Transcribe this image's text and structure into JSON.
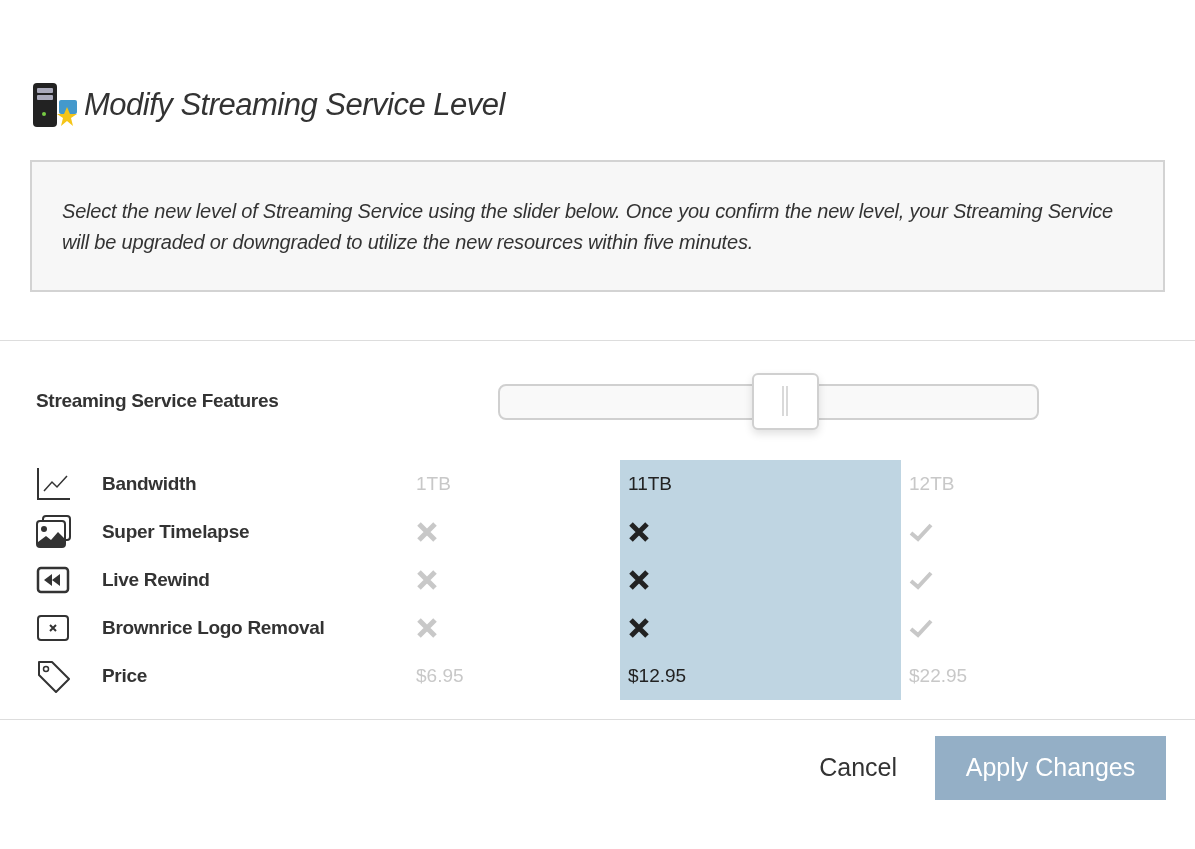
{
  "dialog": {
    "title": "Modify Streaming Service Level"
  },
  "info": "Select the new level of Streaming Service using the slider below. Once you confirm the new level, your Streaming Service will be upgraded or downgraded to utilize the new resources within five minutes.",
  "features_heading": "Streaming Service Features",
  "slider": {
    "level": 0.53
  },
  "tiers": [
    {
      "selected": false
    },
    {
      "selected": true
    },
    {
      "selected": false
    }
  ],
  "features": [
    {
      "kind": "chart",
      "label": "Bandwidth",
      "cells": [
        {
          "kind": "text",
          "text": "1TB"
        },
        {
          "kind": "text",
          "text": "11TB"
        },
        {
          "kind": "text",
          "text": "12TB"
        }
      ]
    },
    {
      "kind": "images",
      "label": "Super Timelapse",
      "cells": [
        {
          "kind": "flag",
          "included": false
        },
        {
          "kind": "flag",
          "included": false
        },
        {
          "kind": "flag",
          "included": true
        }
      ]
    },
    {
      "kind": "rewind",
      "label": "Live Rewind",
      "cells": [
        {
          "kind": "flag",
          "included": false
        },
        {
          "kind": "flag",
          "included": false
        },
        {
          "kind": "flag",
          "included": true
        }
      ]
    },
    {
      "kind": "xbox",
      "label": "Brownrice Logo Removal",
      "cells": [
        {
          "kind": "flag",
          "included": false
        },
        {
          "kind": "flag",
          "included": false
        },
        {
          "kind": "flag",
          "included": true
        }
      ]
    },
    {
      "kind": "tag",
      "label": "Price",
      "cells": [
        {
          "kind": "text",
          "text": "$6.95"
        },
        {
          "kind": "text",
          "text": "$12.95"
        },
        {
          "kind": "text",
          "text": "$22.95"
        }
      ]
    }
  ],
  "buttons": {
    "cancel": "Cancel",
    "apply": {
      "label": "Apply Changes",
      "disabled": true
    }
  }
}
